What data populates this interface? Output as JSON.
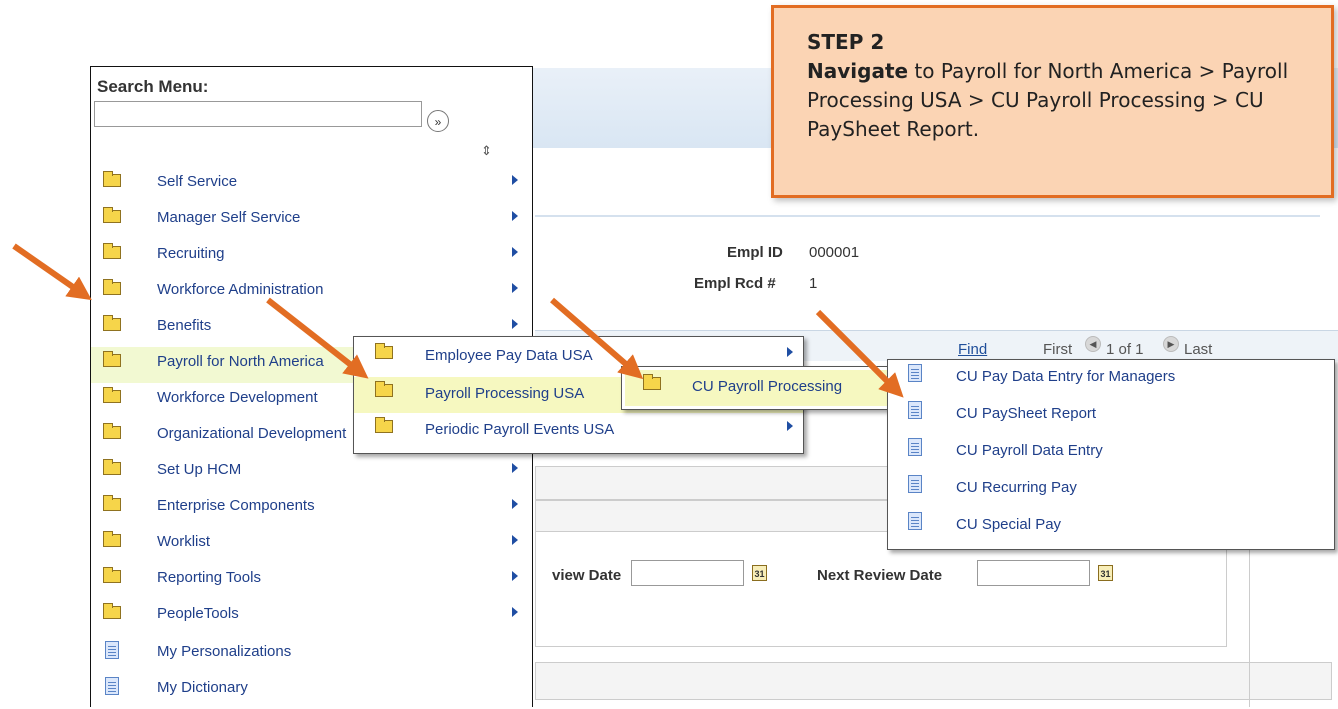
{
  "search_menu": {
    "title": "Search Menu:",
    "input_value": "",
    "go_label": "»"
  },
  "menu": {
    "items": [
      {
        "label": "Self Service",
        "icon": "folder-icon",
        "has_submenu": true
      },
      {
        "label": "Manager Self Service",
        "icon": "folder-icon",
        "has_submenu": true
      },
      {
        "label": "Recruiting",
        "icon": "folder-icon",
        "has_submenu": true
      },
      {
        "label": "Workforce Administration",
        "icon": "folder-icon",
        "has_submenu": true
      },
      {
        "label": "Benefits",
        "icon": "folder-icon",
        "has_submenu": true
      },
      {
        "label": "Payroll for North America",
        "icon": "folder-icon",
        "has_submenu": true,
        "highlighted": true
      },
      {
        "label": "Workforce Development",
        "icon": "folder-icon",
        "has_submenu": true
      },
      {
        "label": "Organizational Development",
        "icon": "folder-icon",
        "has_submenu": true
      },
      {
        "label": "Set Up HCM",
        "icon": "folder-icon",
        "has_submenu": true
      },
      {
        "label": "Enterprise Components",
        "icon": "folder-icon",
        "has_submenu": true
      },
      {
        "label": "Worklist",
        "icon": "folder-icon",
        "has_submenu": true
      },
      {
        "label": "Reporting Tools",
        "icon": "folder-icon",
        "has_submenu": true
      },
      {
        "label": "PeopleTools",
        "icon": "folder-icon",
        "has_submenu": true
      },
      {
        "label": "My Personalizations",
        "icon": "page-icon",
        "has_submenu": false
      },
      {
        "label": "My Dictionary",
        "icon": "page-icon",
        "has_submenu": false
      }
    ]
  },
  "flyout1": {
    "items": [
      {
        "label": "Employee Pay Data USA",
        "icon": "folder-icon"
      },
      {
        "label": "Payroll Processing USA",
        "icon": "folder-icon",
        "highlighted": true
      },
      {
        "label": "Periodic Payroll Events USA",
        "icon": "folder-icon"
      }
    ]
  },
  "flyout2": {
    "items": [
      {
        "label": "CU Payroll Processing",
        "icon": "folder-icon",
        "highlighted": true
      }
    ]
  },
  "flyout3": {
    "items": [
      {
        "label": "CU Pay Data Entry for Managers",
        "icon": "page-icon"
      },
      {
        "label": "CU PaySheet Report",
        "icon": "page-icon"
      },
      {
        "label": "CU Payroll Data Entry",
        "icon": "page-icon"
      },
      {
        "label": "CU Recurring Pay",
        "icon": "page-icon"
      },
      {
        "label": "CU Special Pay",
        "icon": "page-icon"
      }
    ]
  },
  "background": {
    "empl_id_label": "Empl ID",
    "empl_id_value": "000001",
    "empl_rcd_label": "Empl Rcd #",
    "empl_rcd_value": "1",
    "grid_find": "Find",
    "grid_first": "First",
    "grid_count": "1 of 1",
    "grid_last": "Last",
    "review_date_label": "view Date",
    "next_review_date_label": "Next Review Date"
  },
  "callout": {
    "title": "STEP 2",
    "bold_word": "Navigate",
    "text": " to Payroll for North America > Payroll Processing USA > CU Payroll Processing > CU PaySheet Report."
  },
  "colors": {
    "callout_fill": "#fbd4b4",
    "callout_border": "#e26d23",
    "arrow": "#e26d23",
    "menu_link": "#1f3f8a",
    "highlight": "#f2f9d2"
  }
}
